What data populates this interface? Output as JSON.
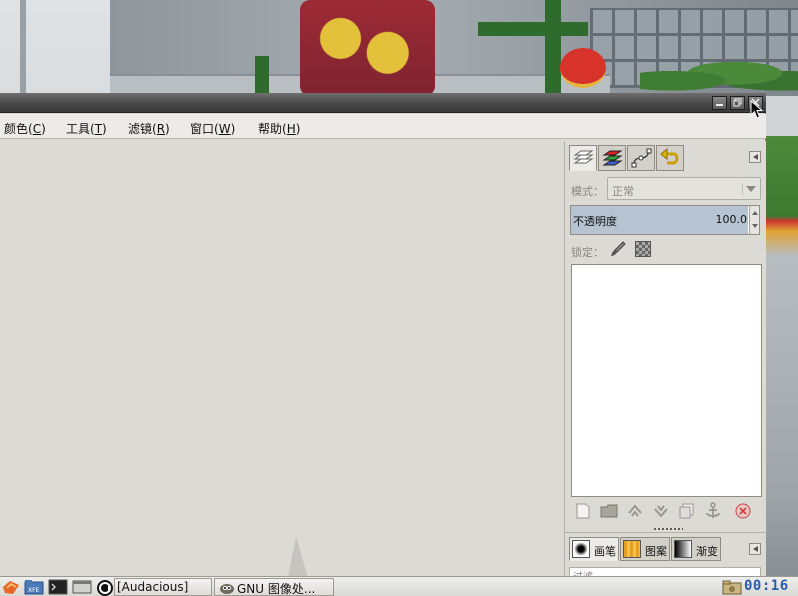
{
  "menubar": {
    "items": [
      {
        "label": "颜色",
        "mnemonic": "C"
      },
      {
        "label": "工具",
        "mnemonic": "T"
      },
      {
        "label": "滤镜",
        "mnemonic": "R"
      },
      {
        "label": "窗口",
        "mnemonic": "W"
      },
      {
        "label": "帮助",
        "mnemonic": "H"
      }
    ]
  },
  "dock": {
    "tabs": [
      "layers-icon",
      "channels-icon",
      "paths-icon",
      "undo-history-icon"
    ],
    "mode_label": "模式：",
    "mode_value": "正常",
    "opacity_label": "不透明度",
    "opacity_value": "100.0",
    "opacity_fraction": 1.0,
    "lock_label": "锁定：",
    "layer_buttons": [
      "new-layer-icon",
      "new-layer-group-icon",
      "raise-layer-icon",
      "lower-layer-icon",
      "duplicate-layer-icon",
      "anchor-layer-icon",
      "delete-layer-icon"
    ]
  },
  "brush_dock": {
    "tabs": [
      {
        "label": "画笔",
        "icon": "brush-icon"
      },
      {
        "label": "图案",
        "icon": "pattern-icon"
      },
      {
        "label": "渐变",
        "icon": "gradient-icon"
      }
    ],
    "filter_placeholder": "过滤"
  },
  "taskbar": {
    "tasks": [
      {
        "label": "[Audacious]"
      },
      {
        "label": "GNU 图像处..."
      }
    ],
    "clock": "00:16"
  },
  "colors": {
    "titlebar": "#4a4a4a",
    "window_bg": "#dcdad5",
    "opacity_fill": "#b6c4d2",
    "clock": "#2a5cad"
  }
}
